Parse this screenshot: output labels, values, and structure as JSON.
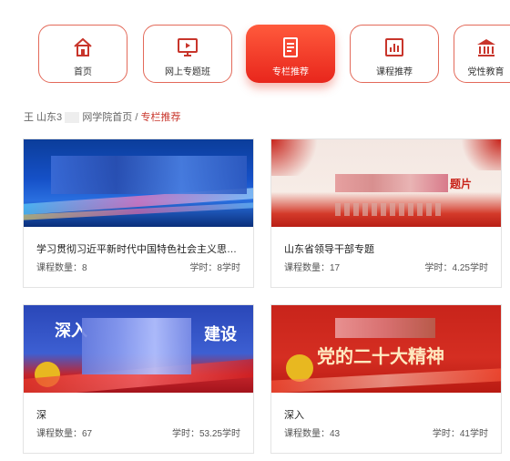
{
  "nav": [
    {
      "label": "首页",
      "icon": "home-icon"
    },
    {
      "label": "网上专题班",
      "icon": "monitor-icon"
    },
    {
      "label": "专栏推荐",
      "icon": "document-icon",
      "active": true
    },
    {
      "label": "课程推荐",
      "icon": "chart-icon"
    },
    {
      "label": "党性教育",
      "icon": "building-icon"
    }
  ],
  "breadcrumb": {
    "prefix": "王 山东3",
    "middle": "网学院首页",
    "sep": " / ",
    "current": "专栏推荐"
  },
  "cards": [
    {
      "title": "学习贯彻习近平新时代中国特色社会主义思…",
      "count_label": "课程数量：8",
      "hours_label": "学时：8学时"
    },
    {
      "title": "山东省领导干部专题",
      "count_label": "课程数量：17",
      "hours_label": "学时：4.25学时"
    },
    {
      "title": "深",
      "count_label": "课程数量：67",
      "hours_label": "学时：53.25学时"
    },
    {
      "title": "深入",
      "count_label": "课程数量：43",
      "hours_label": "学时：41学时"
    }
  ],
  "banners": {
    "card2_tail": "题片",
    "card3_line1": "深入",
    "card3_line2": "建设",
    "card4_line": "党的二十大精神"
  },
  "colors": {
    "accent": "#e8261c",
    "border": "#e36a5a"
  }
}
